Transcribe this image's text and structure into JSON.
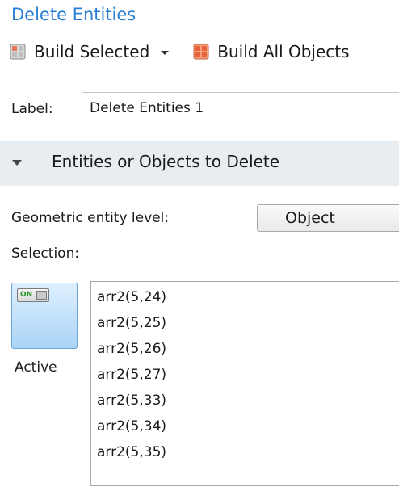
{
  "header": {
    "title": "Delete Entities"
  },
  "toolbar": {
    "build_selected_label": "Build Selected",
    "build_all_label": "Build All Objects"
  },
  "settings": {
    "label_caption": "Label:",
    "label_value": "Delete Entities 1"
  },
  "section": {
    "title": "Entities or Objects to Delete",
    "geometric_entity_level_label": "Geometric entity level:",
    "geometric_entity_level_value": "Object",
    "selection_label": "Selection:",
    "active_toggle_text": "ON",
    "active_label": "Active",
    "selection_items": [
      "arr2(5,24)",
      "arr2(5,25)",
      "arr2(5,26)",
      "arr2(5,27)",
      "arr2(5,33)",
      "arr2(5,34)",
      "arr2(5,35)"
    ]
  },
  "colors": {
    "title_blue": "#2a7fd4",
    "section_bg": "#e8edf2",
    "active_button_blue": "#a9d4f6",
    "toggle_on_green": "#2c9a2c"
  },
  "icons": {
    "build_selected": "build-selected-icon",
    "build_all": "build-all-icon",
    "dropdown": "chevron-down-icon",
    "section_collapse": "triangle-down-icon"
  }
}
